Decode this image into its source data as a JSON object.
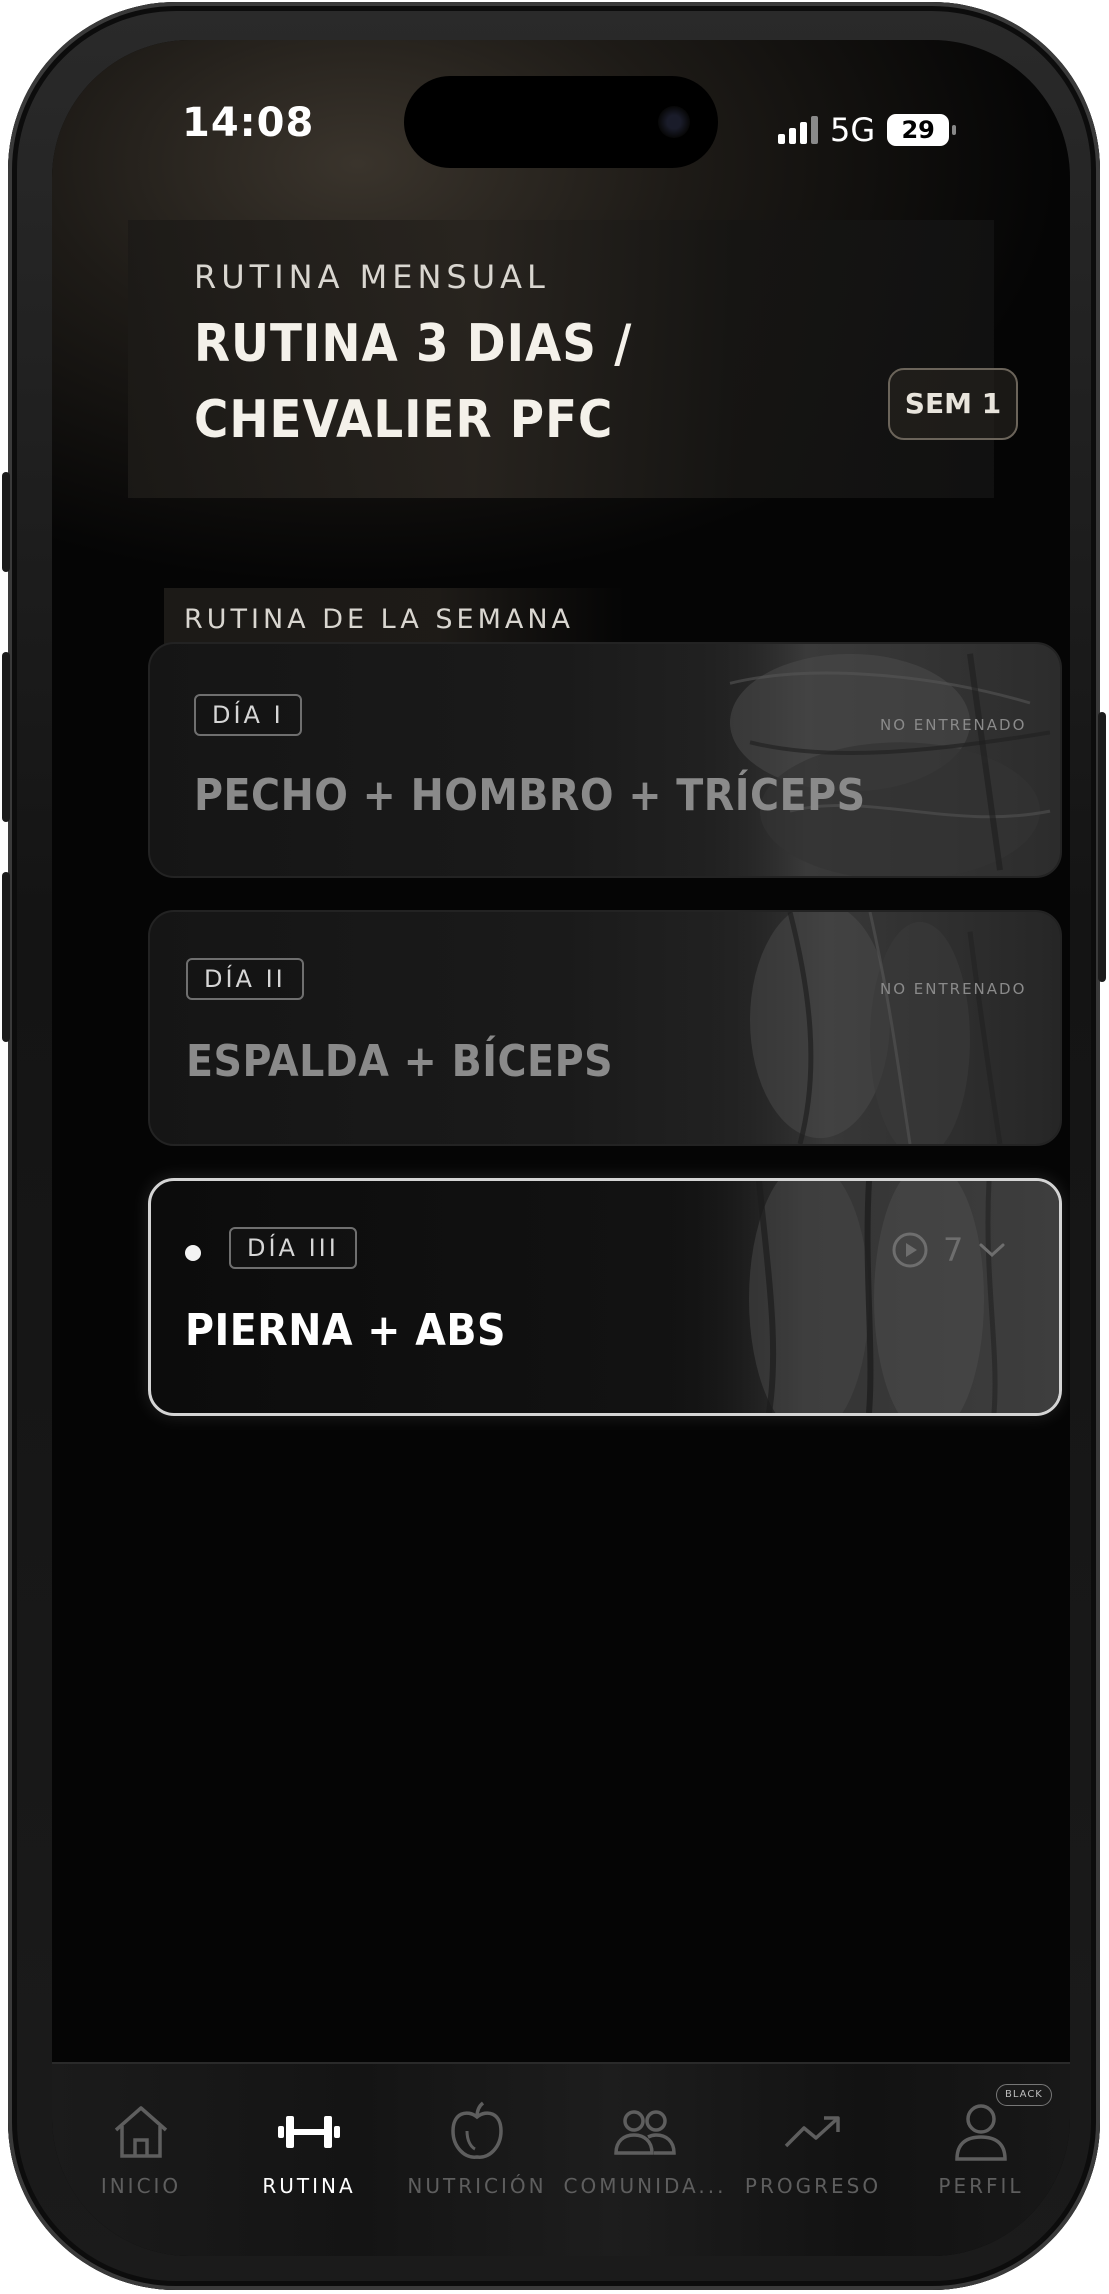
{
  "status_bar": {
    "time": "14:08",
    "network": "5G",
    "battery": "29"
  },
  "header": {
    "eyebrow": "RUTINA MENSUAL",
    "title": "RUTINA 3 DIAS / CHEVALIER PFC",
    "week_badge": "SEM 1"
  },
  "section": {
    "label": "RUTINA DE LA SEMANA"
  },
  "days": [
    {
      "tag": "DÍA I",
      "title": "PECHO + HOMBRO + TRÍCEPS",
      "status": "NO ENTRENADO",
      "active": false
    },
    {
      "tag": "DÍA II",
      "title": "ESPALDA + BÍCEPS",
      "status": "NO ENTRENADO",
      "active": false
    },
    {
      "tag": "DÍA III",
      "title": "PIERNA + ABS",
      "exercise_count": "7",
      "active": true
    }
  ],
  "tab_bar": {
    "tabs": [
      {
        "label": "INICIO",
        "icon": "home-icon",
        "active": false
      },
      {
        "label": "RUTINA",
        "icon": "dumbbell-icon",
        "active": true
      },
      {
        "label": "NUTRICIÓN",
        "icon": "apple-icon",
        "active": false
      },
      {
        "label": "COMUNIDA...",
        "icon": "people-icon",
        "active": false
      },
      {
        "label": "PROGRESO",
        "icon": "trend-up-icon",
        "active": false
      },
      {
        "label": "PERFIL",
        "icon": "user-icon",
        "active": false
      }
    ],
    "profile_badge": "BLACK"
  },
  "colors": {
    "background": "#050505",
    "accent_text": "#f4f1ea",
    "dim_text": "#8a8a8a",
    "active_border": "#d4d4d4"
  }
}
